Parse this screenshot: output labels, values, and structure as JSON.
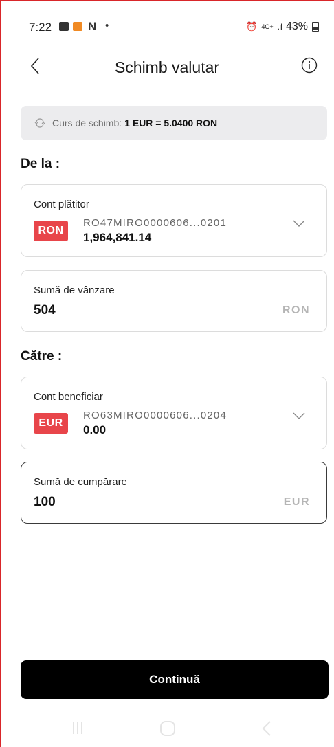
{
  "status_bar": {
    "time": "7:22",
    "network": "4G+",
    "battery": "43%"
  },
  "header": {
    "title": "Schimb valutar"
  },
  "rate": {
    "prefix": "Curs de schimb:",
    "value": "1 EUR = 5.0400 RON"
  },
  "from": {
    "section_title": "De la :",
    "account": {
      "label": "Cont plătitor",
      "currency": "RON",
      "iban": "RO47MIRO0000606...0201",
      "balance": "1,964,841.14"
    },
    "amount": {
      "label": "Sumă de vânzare",
      "value": "504",
      "currency": "RON"
    }
  },
  "to": {
    "section_title": "Către :",
    "account": {
      "label": "Cont beneficiar",
      "currency": "EUR",
      "iban": "RO63MIRO0000606...0204",
      "balance": "0.00"
    },
    "amount": {
      "label": "Sumă de cumpărare",
      "value": "100",
      "currency": "EUR"
    }
  },
  "actions": {
    "continue_label": "Continuă"
  },
  "colors": {
    "badge_red": "#e8454a",
    "button_black": "#000000",
    "frame_red": "#d9262a"
  }
}
